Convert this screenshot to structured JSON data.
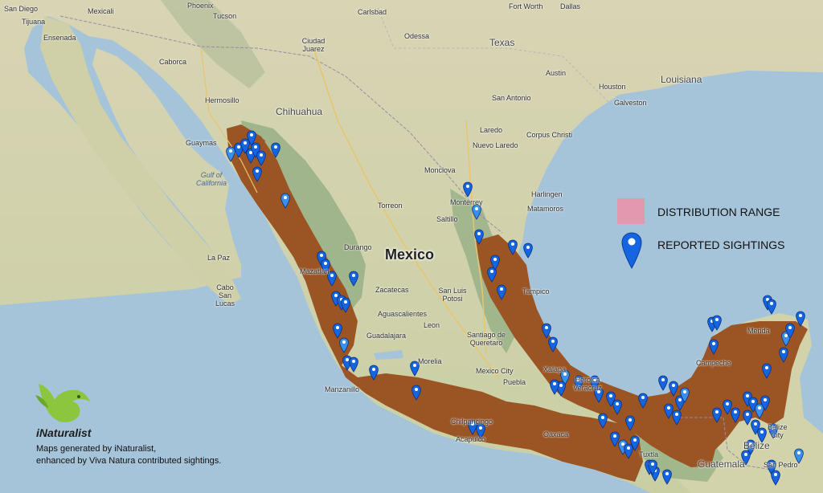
{
  "map": {
    "country_label": "Mexico",
    "states": [
      {
        "id": "texas",
        "label": "Texas"
      },
      {
        "id": "louisiana",
        "label": "Louisiana"
      },
      {
        "id": "chihuahua",
        "label": "Chihuahua"
      }
    ],
    "seas": [
      {
        "id": "gulf-california",
        "label": "Gulf of California"
      }
    ],
    "cities": [
      {
        "id": "san-diego",
        "label": "San Diego"
      },
      {
        "id": "tijuana",
        "label": "Tijuana"
      },
      {
        "id": "mexicali",
        "label": "Mexicali"
      },
      {
        "id": "ensenada",
        "label": "Ensenada"
      },
      {
        "id": "phoenix",
        "label": "Phoenix"
      },
      {
        "id": "tucson",
        "label": "Tucson"
      },
      {
        "id": "hermosillo",
        "label": "Hermosillo"
      },
      {
        "id": "carlsbad",
        "label": "Carlsbad"
      },
      {
        "id": "fort-worth",
        "label": "Fort Worth"
      },
      {
        "id": "dallas",
        "label": "Dallas"
      },
      {
        "id": "odessa",
        "label": "Odessa"
      },
      {
        "id": "ciudad-juarez",
        "label": "Ciudad Juarez"
      },
      {
        "id": "caborca",
        "label": "Caborca"
      },
      {
        "id": "austin",
        "label": "Austin"
      },
      {
        "id": "houston",
        "label": "Houston"
      },
      {
        "id": "san-antonio",
        "label": "San Antonio"
      },
      {
        "id": "galveston",
        "label": "Galveston"
      },
      {
        "id": "corpus-christi",
        "label": "Corpus Christi"
      },
      {
        "id": "laredo",
        "label": "Laredo"
      },
      {
        "id": "nuevo-laredo",
        "label": "Nuevo Laredo"
      },
      {
        "id": "guaymas",
        "label": "Guaymas"
      },
      {
        "id": "monclova",
        "label": "Monclova"
      },
      {
        "id": "torreon",
        "label": "Torreon"
      },
      {
        "id": "monterrey",
        "label": "Monterrey"
      },
      {
        "id": "saltillo",
        "label": "Saltillo"
      },
      {
        "id": "harlingen",
        "label": "Harlingen"
      },
      {
        "id": "matamoros",
        "label": "Matamoros"
      },
      {
        "id": "durango",
        "label": "Durango"
      },
      {
        "id": "mazatlan",
        "label": "Mazatlan"
      },
      {
        "id": "zacatecas",
        "label": "Zacatecas"
      },
      {
        "id": "san-luis-potosi",
        "label": "San Luis Potosi"
      },
      {
        "id": "tampico",
        "label": "Tampico"
      },
      {
        "id": "aguascalientes",
        "label": "Aguascalientes"
      },
      {
        "id": "guadalajara",
        "label": "Guadalajara"
      },
      {
        "id": "leon",
        "label": "Leon"
      },
      {
        "id": "queretaro",
        "label": "Santiago de Queretaro"
      },
      {
        "id": "mexico-city",
        "label": "Mexico City"
      },
      {
        "id": "puebla",
        "label": "Puebla"
      },
      {
        "id": "xalapa",
        "label": "Xalapa"
      },
      {
        "id": "veracruz",
        "label": "Heroica Veracruz"
      },
      {
        "id": "manzanillo",
        "label": "Manzanillo"
      },
      {
        "id": "morelia",
        "label": "Morelia"
      },
      {
        "id": "chilpancingo",
        "label": "Chilpancingo"
      },
      {
        "id": "acapulco",
        "label": "Acapulco"
      },
      {
        "id": "oaxaca",
        "label": "Oaxaca"
      },
      {
        "id": "tuxtla",
        "label": "Tuxtla"
      },
      {
        "id": "campeche",
        "label": "Campeche"
      },
      {
        "id": "merida",
        "label": "Merida"
      },
      {
        "id": "belize-city",
        "label": "Belize City"
      },
      {
        "id": "belize",
        "label": "Belize"
      },
      {
        "id": "guatemala",
        "label": "Guatemala"
      },
      {
        "id": "san-pedro",
        "label": "San Pedro"
      },
      {
        "id": "cabo",
        "label": "Cabo San Lucas"
      },
      {
        "id": "la-paz",
        "label": "La Paz"
      }
    ]
  },
  "legend": {
    "range_label": "DISTRIBUTION RANGE",
    "range_color": "#e398b0",
    "sightings_label": "REPORTED SIGHTINGS",
    "pin_color": "#1565e0"
  },
  "branding": {
    "logo_text": "iNaturalist",
    "credit_line1": "Maps generated by iNaturalist,",
    "credit_line2": "enhanced by Viva Natura contributed sightings."
  },
  "colors": {
    "water": "#a6c4d9",
    "land": "#d9d5b0",
    "mountains": "#8fab80",
    "range_fill": "#9b5524"
  }
}
